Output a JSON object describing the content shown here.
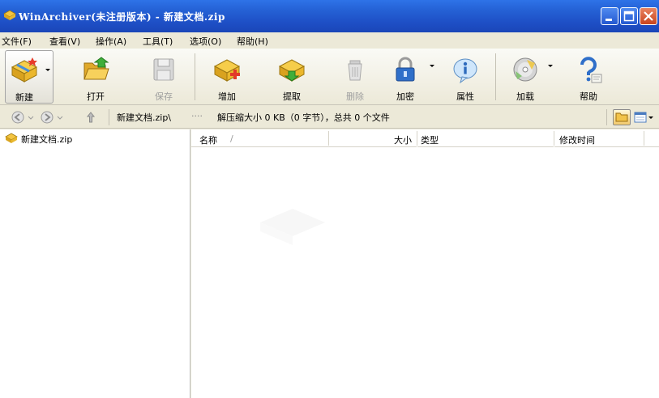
{
  "window": {
    "title": "WinArchiver(未注册版本) - 新建文档.zip"
  },
  "menu": [
    {
      "label": "文件(F)"
    },
    {
      "label": "查看(V)"
    },
    {
      "label": "操作(A)"
    },
    {
      "label": "工具(T)"
    },
    {
      "label": "选项(O)"
    },
    {
      "label": "帮助(H)"
    }
  ],
  "toolbar": [
    {
      "label": "新建",
      "icon": "new-archive-icon",
      "enabled": true
    },
    {
      "label": "打开",
      "icon": "open-folder-icon",
      "enabled": true
    },
    {
      "label": "保存",
      "icon": "save-icon",
      "enabled": false
    },
    {
      "label": "增加",
      "icon": "add-files-icon",
      "enabled": true
    },
    {
      "label": "提取",
      "icon": "extract-icon",
      "enabled": true
    },
    {
      "label": "删除",
      "icon": "delete-icon",
      "enabled": false
    },
    {
      "label": "加密",
      "icon": "lock-icon",
      "enabled": true
    },
    {
      "label": "属性",
      "icon": "info-icon",
      "enabled": true
    },
    {
      "label": "加载",
      "icon": "load-disc-icon",
      "enabled": true
    },
    {
      "label": "帮助",
      "icon": "help-icon",
      "enabled": true
    }
  ],
  "address": {
    "path": "新建文档.zip\\",
    "separator": "····",
    "summary": "解压缩大小 0 KB（0 字节），总共 0 个文件"
  },
  "tree": {
    "root_label": "新建文档.zip"
  },
  "columns": [
    {
      "label": "名称",
      "sort_indicator": "/"
    },
    {
      "label": "大小"
    },
    {
      "label": "类型"
    },
    {
      "label": "修改时间"
    }
  ],
  "colors": {
    "titlebar": "#2458d0",
    "window_bg": "#ece9d8"
  }
}
